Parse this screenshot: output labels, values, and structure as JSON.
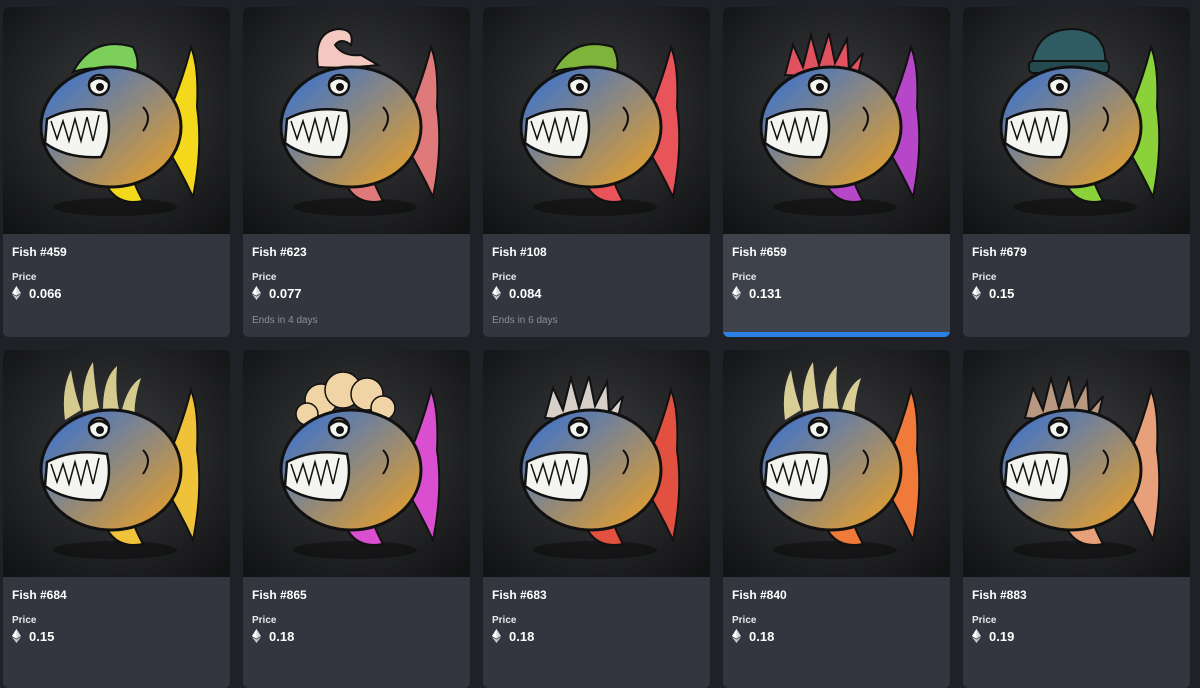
{
  "labels": {
    "price": "Price"
  },
  "colors": {
    "accent": "#2b81e3",
    "card": "#33363e",
    "card_selected": "#3d424b",
    "page": "#1f2126"
  },
  "icon": "ethereum-icon",
  "items": [
    {
      "name": "Fish #459",
      "price": "0.066",
      "ends": "",
      "bg": "dark",
      "body": "#f2a21f",
      "head": "#2e6fd9",
      "fin": "#f4d81c",
      "hair": "mohawk",
      "hair_color": "#7ccf5a",
      "selected": false
    },
    {
      "name": "Fish #623",
      "price": "0.077",
      "ends": "Ends in 4 days",
      "bg": "light",
      "body": "#e5534f",
      "head": "#e8645e",
      "fin": "#e07a7a",
      "hair": "curl",
      "hair_color": "#f2c8c0",
      "selected": false
    },
    {
      "name": "Fish #108",
      "price": "0.084",
      "ends": "Ends in 6 days",
      "bg": "light",
      "body": "#49c08a",
      "head": "#f2932a",
      "fin": "#e8545a",
      "hair": "mohawk",
      "hair_color": "#7fb43c",
      "selected": false
    },
    {
      "name": "Fish #659",
      "price": "0.131",
      "ends": "",
      "bg": "dark",
      "body": "#c05ad8",
      "head": "#8fa8f0",
      "fin": "#b647c9",
      "hair": "spikes",
      "hair_color": "#e0525f",
      "selected": true
    },
    {
      "name": "Fish #679",
      "price": "0.15",
      "ends": "",
      "bg": "dark",
      "body": "#3ee08a",
      "head": "#2fd9b8",
      "fin": "#8ad13a",
      "hair": "beanie",
      "hair_color": "#2f5c63",
      "selected": false
    },
    {
      "name": "Fish #684",
      "price": "0.15",
      "ends": "",
      "bg": "light",
      "body": "#2fd8a8",
      "head": "#39c2e8",
      "fin": "#f0c23a",
      "hair": "fire",
      "hair_color": "#f3e7a0",
      "selected": false
    },
    {
      "name": "Fish #865",
      "price": "0.18",
      "ends": "",
      "bg": "dark",
      "body": "#e53fb2",
      "head": "#f05ab8",
      "fin": "#d94fd0",
      "hair": "fluffy",
      "hair_color": "#f1d4a6",
      "selected": false
    },
    {
      "name": "Fish #683",
      "price": "0.18",
      "ends": "",
      "bg": "dark",
      "body": "#d93a3f",
      "head": "#e83048",
      "fin": "#e25040",
      "hair": "spikes",
      "hair_color": "#d8cfc8",
      "selected": false
    },
    {
      "name": "Fish #840",
      "price": "0.18",
      "ends": "",
      "bg": "dark",
      "body": "#d8ea8a",
      "head": "#e8e48a",
      "fin": "#f07a3a",
      "hair": "fire",
      "hair_color": "#f6eaa8",
      "selected": false
    },
    {
      "name": "Fish #883",
      "price": "0.19",
      "ends": "",
      "bg": "light",
      "body": "#bfe07a",
      "head": "#e0d890",
      "fin": "#e8a07a",
      "hair": "spikes",
      "hair_color": "#b89880",
      "selected": false
    }
  ]
}
